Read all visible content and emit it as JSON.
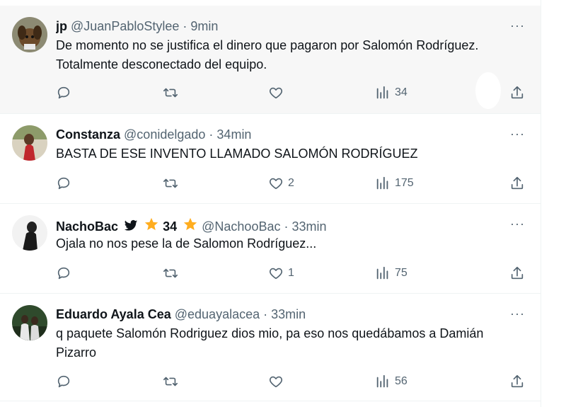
{
  "tweets": [
    {
      "name": "jp",
      "handle": "@JuanPabloStylee",
      "time": "9min",
      "text": "De momento no se justifica el dinero que pagaron por Salomón Rodríguez. Totalmente desconectado del equipo.",
      "replies": "",
      "retweets": "",
      "likes": "",
      "views": "34",
      "highlighted": true
    },
    {
      "name": "Constanza",
      "handle": "@conidelgado",
      "time": "34min",
      "text": "BASTA DE ESE INVENTO LLAMADO SALOMÓN RODRÍGUEZ",
      "replies": "",
      "retweets": "",
      "likes": "2",
      "views": "175"
    },
    {
      "name": "NachoBac",
      "badge_count": "34",
      "handle": "@NachooBac",
      "time": "33min",
      "text": "Ojala no nos pese la de Salomon Rodríguez...",
      "replies": "",
      "retweets": "",
      "likes": "1",
      "views": "75"
    },
    {
      "name": "Eduardo Ayala Cea",
      "handle": "@eduayalacea",
      "time": "33min",
      "text": "q paquete Salomón Rodriguez dios mio, pa eso nos quedábamos a Damián Pizarro",
      "replies": "",
      "retweets": "",
      "likes": "",
      "views": "56"
    }
  ],
  "more_label": "···",
  "separator": "·",
  "colors": {
    "text": "#0f1419",
    "muted": "#536471",
    "star": "#ffad1f",
    "divider": "#eff3f4"
  },
  "icons": [
    "reply-icon",
    "retweet-icon",
    "like-icon",
    "views-icon",
    "share-icon",
    "bird-icon",
    "star-icon",
    "more-icon"
  ]
}
